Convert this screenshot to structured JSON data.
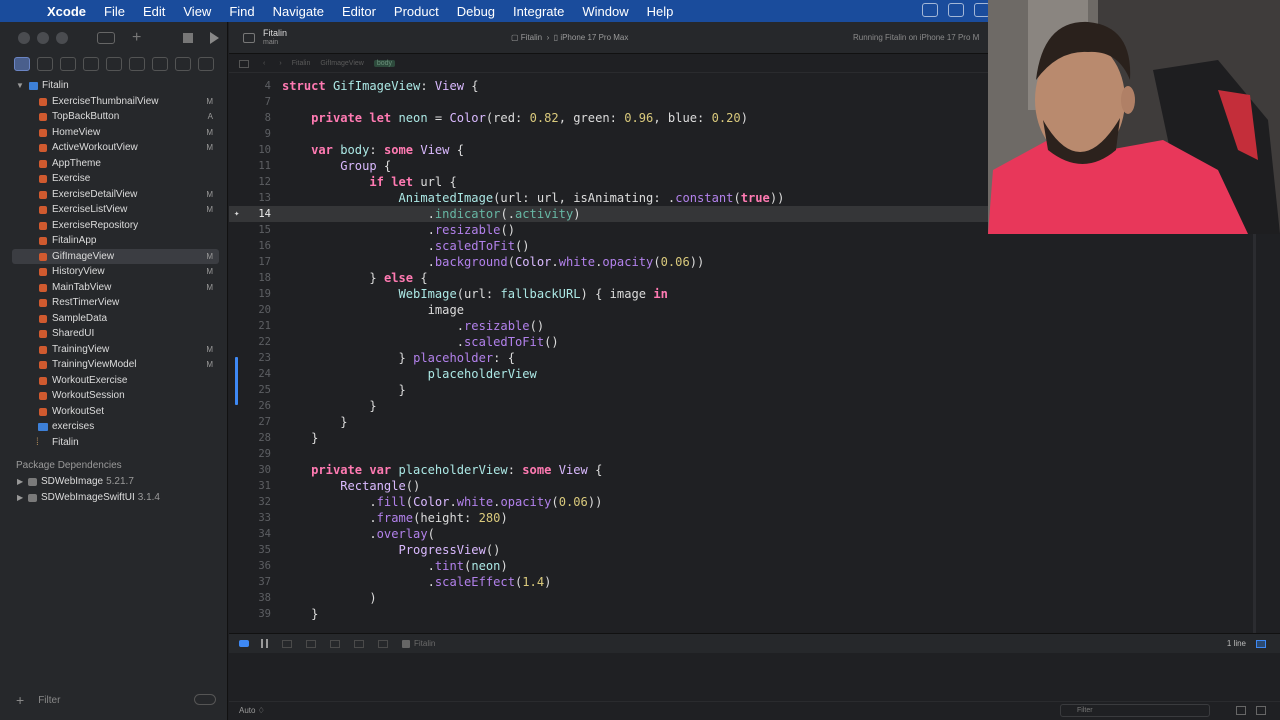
{
  "menubar": {
    "app": "Xcode",
    "items": [
      "File",
      "Edit",
      "View",
      "Find",
      "Navigate",
      "Editor",
      "Product",
      "Debug",
      "Integrate",
      "Window",
      "Help"
    ]
  },
  "toolbar": {
    "project": "Fitalin",
    "branch": "main",
    "scheme": "Fitalin",
    "destination": "iPhone 17 Pro Max",
    "status": "Running Fitalin on iPhone 17 Pro M"
  },
  "jumpbar": {
    "crumbs": [
      "Fitalin",
      "GifImageView",
      "body"
    ]
  },
  "navigator": {
    "root": "Fitalin",
    "files": [
      {
        "name": "ExerciseThumbnailView",
        "badge": "M"
      },
      {
        "name": "TopBackButton",
        "badge": "A"
      },
      {
        "name": "HomeView",
        "badge": "M"
      },
      {
        "name": "ActiveWorkoutView",
        "badge": "M"
      },
      {
        "name": "AppTheme",
        "badge": ""
      },
      {
        "name": "Exercise",
        "badge": ""
      },
      {
        "name": "ExerciseDetailView",
        "badge": "M"
      },
      {
        "name": "ExerciseListView",
        "badge": "M"
      },
      {
        "name": "ExerciseRepository",
        "badge": ""
      },
      {
        "name": "FitalinApp",
        "badge": ""
      },
      {
        "name": "GifImageView",
        "badge": "M"
      },
      {
        "name": "HistoryView",
        "badge": "M"
      },
      {
        "name": "MainTabView",
        "badge": "M"
      },
      {
        "name": "RestTimerView",
        "badge": ""
      },
      {
        "name": "SampleData",
        "badge": ""
      },
      {
        "name": "SharedUI",
        "badge": ""
      },
      {
        "name": "TrainingView",
        "badge": "M"
      },
      {
        "name": "TrainingViewModel",
        "badge": "M"
      },
      {
        "name": "WorkoutExercise",
        "badge": ""
      },
      {
        "name": "WorkoutSession",
        "badge": ""
      },
      {
        "name": "WorkoutSet",
        "badge": ""
      }
    ],
    "folder": "exercises",
    "product": "Fitalin",
    "package_header": "Package Dependencies",
    "packages": [
      {
        "name": "SDWebImage",
        "version": "5.21.7"
      },
      {
        "name": "SDWebImageSwiftUI",
        "version": "3.1.4"
      }
    ],
    "filter_placeholder": "Filter"
  },
  "editor": {
    "line_numbers": [
      "4",
      "7",
      "8",
      "9",
      "10",
      "11",
      "12",
      "13",
      "14",
      "15",
      "16",
      "17",
      "18",
      "19",
      "20",
      "21",
      "22",
      "23",
      "24",
      "25",
      "26",
      "27",
      "28",
      "29",
      "30",
      "31",
      "32",
      "33",
      "34",
      "35",
      "36",
      "37",
      "38",
      "39"
    ],
    "current_line": "14"
  },
  "debug": {
    "process": "Fitalin",
    "line_count": "1 line",
    "console_mode": "Auto ♢",
    "filter_placeholder": "Filter"
  },
  "colors": {
    "menubar": "#1a4c9c",
    "keyword": "#ff7ab2",
    "type": "#dabaff",
    "method": "#67b7a4",
    "number": "#d9c97c",
    "identifier": "#ace8e5",
    "accent": "#3e89f5"
  }
}
